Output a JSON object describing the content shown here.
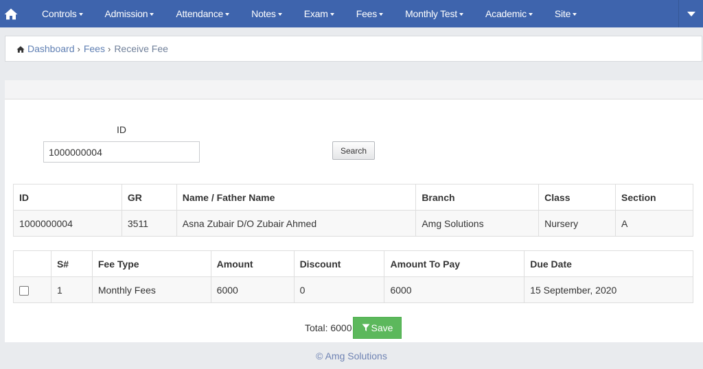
{
  "navbar": {
    "items": [
      {
        "label": "Controls"
      },
      {
        "label": "Admission"
      },
      {
        "label": "Attendance"
      },
      {
        "label": "Notes"
      },
      {
        "label": "Exam"
      },
      {
        "label": "Fees"
      },
      {
        "label": "Monthly Test"
      },
      {
        "label": "Academic"
      },
      {
        "label": "Site"
      }
    ]
  },
  "breadcrumb": {
    "dashboard": "Dashboard",
    "fees": "Fees",
    "current": "Receive Fee",
    "sep": "›"
  },
  "search": {
    "id_label": "ID",
    "id_value": "1000000004",
    "button_label": "Search"
  },
  "student_table": {
    "headers": [
      "ID",
      "GR",
      "Name / Father Name",
      "Branch",
      "Class",
      "Section"
    ],
    "row": [
      "1000000004",
      "3511",
      "Asna Zubair D/O Zubair Ahmed",
      "Amg Solutions",
      "Nursery",
      "A"
    ]
  },
  "fee_table": {
    "headers": [
      "",
      "S#",
      "Fee Type",
      "Amount",
      "Discount",
      "Amount To Pay",
      "Due Date"
    ],
    "row": [
      "",
      "1",
      "Monthly Fees",
      "6000",
      "0",
      "6000",
      "15 September, 2020"
    ],
    "row_checked": false
  },
  "summary": {
    "total_label": "Total: 6000",
    "save_label": "Save"
  },
  "footer": {
    "text": "© Amg Solutions"
  },
  "colors": {
    "navbar": "#3e64ad",
    "link": "#5f7fb3",
    "save": "#5cb85c"
  }
}
